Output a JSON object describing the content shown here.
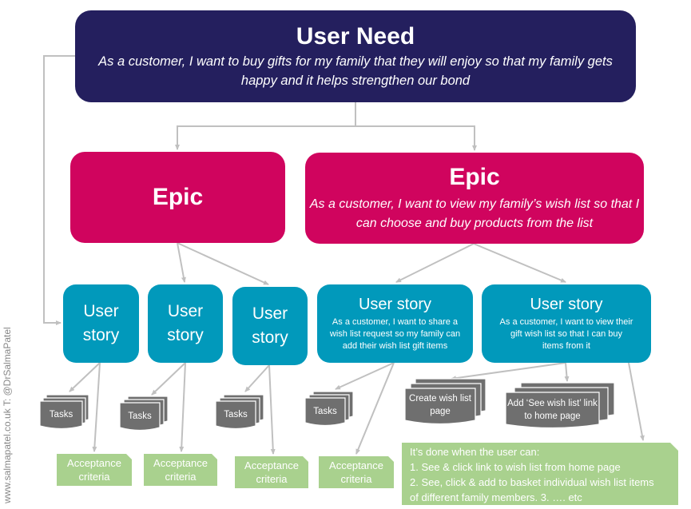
{
  "user_need": {
    "title": "User Need",
    "description": "As a customer, I want to buy gifts for my family that they will enjoy so that my family gets happy and it helps strengthen our bond"
  },
  "epics": [
    {
      "title": "Epic",
      "description": ""
    },
    {
      "title": "Epic",
      "description": "As a customer, I want to view my family’s wish list so that I can choose and buy products from the list"
    }
  ],
  "user_stories": [
    {
      "title_line1": "User",
      "title_line2": "story",
      "description": ""
    },
    {
      "title_line1": "User",
      "title_line2": "story",
      "description": ""
    },
    {
      "title_line1": "User",
      "title_line2": "story",
      "description": ""
    },
    {
      "title": "User story",
      "description": "As a customer, I want to share a wish list request so my family can add their wish list gift items"
    },
    {
      "title": "User story",
      "description": "As a customer, I want to view their gift wish list so that I can buy items from it"
    }
  ],
  "tasks": [
    {
      "label": "Tasks"
    },
    {
      "label": "Tasks"
    },
    {
      "label": "Tasks"
    },
    {
      "label": "Tasks"
    },
    {
      "label": "Create wish list page"
    },
    {
      "label": "Add ‘See wish list’ link to home page"
    }
  ],
  "acceptance_criteria": [
    {
      "line1": "Acceptance",
      "line2": "criteria"
    },
    {
      "line1": "Acceptance",
      "line2": "criteria"
    },
    {
      "line1": "Acceptance",
      "line2": "criteria"
    },
    {
      "line1": "Acceptance",
      "line2": "criteria"
    }
  ],
  "definition_of_done": {
    "heading": "It’s done when the user can:",
    "item1": "1. See & click link to wish list from home page",
    "item2": "2. See, click & add to basket individual wish list items",
    "item3": "of different family members.  3. …. etc"
  },
  "watermark": "www.salmapatel.co.uk  T: @DrSalmaPatel",
  "colors": {
    "user_need": "#241f5e",
    "epic": "#d0045e",
    "user_story": "#0199bb",
    "task": "#6f6f6f",
    "acceptance": "#a9d18e",
    "connector": "#c0c0c0"
  }
}
